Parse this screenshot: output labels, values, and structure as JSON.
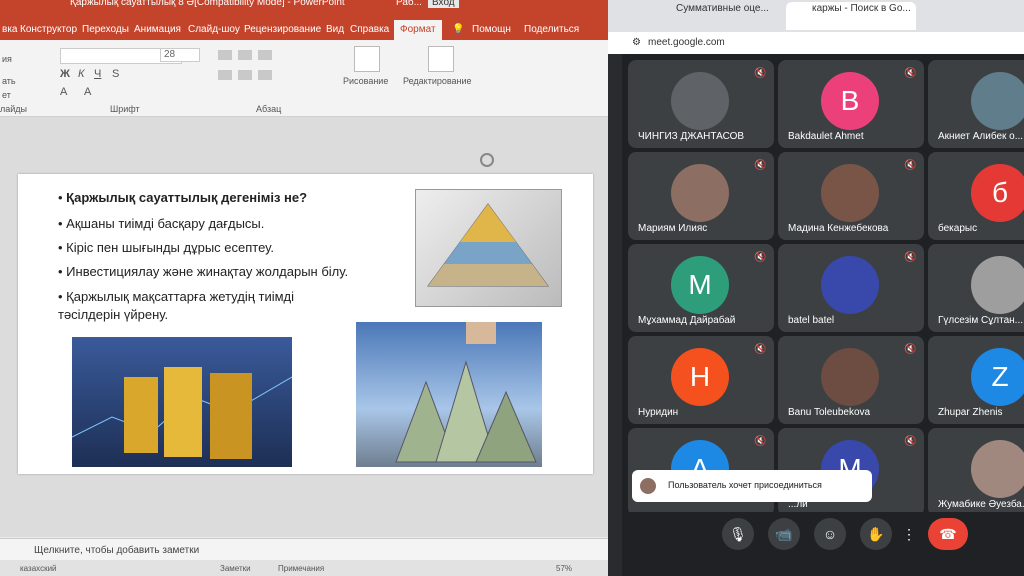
{
  "ppt": {
    "title": "Қаржылық сауаттылық 8 Ә[Compatibility Mode]  -  PowerPoint",
    "title_short": "Раб...",
    "login_label": "Вход",
    "tabs": [
      "вка",
      "Конструктор",
      "Переходы",
      "Анимация",
      "Слайд-шоу",
      "Рецензирование",
      "Вид",
      "Справка",
      "Формат",
      "Помощн",
      "Поделиться"
    ],
    "ribbon": {
      "font_size": "28",
      "section_font": "Шрифт",
      "section_paragraph": "Абзац",
      "section_slides": "лайды",
      "drawing": "Рисование",
      "editing": "Редактирование",
      "left_items": [
        "ать",
        "ет",
        "ия"
      ]
    },
    "slide": {
      "bullets": [
        "Қаржылық сауаттылық дегеніміз не?",
        "Ақшаны тиімді басқару дағдысы.",
        "Кіріс пен шығынды дұрыс есептеу.",
        "Инвестициялау және жинақтау жолдарын білу.",
        "Қаржылық мақсаттарға жетудің тиімді тәсілдерін үйрену."
      ]
    },
    "notes_placeholder": "Щелкните, чтобы добавить заметки",
    "status": {
      "language": "казахский",
      "notes": "Заметки",
      "comments": "Примечания",
      "zoom": "57%"
    }
  },
  "chrome": {
    "tabs": [
      "Суммативные оце...",
      "каржы - Поиск в Go..."
    ],
    "address": "meet.google.com"
  },
  "meet": {
    "participants": [
      {
        "name": "ЧИНГИЗ ДЖАНТАСОВ",
        "initial": "",
        "color": "#5f6368"
      },
      {
        "name": "Bakdaulet Ahmet",
        "initial": "B",
        "color": "#ec407a"
      },
      {
        "name": "Акниет Алибек о...",
        "initial": "",
        "color": "#607d8b"
      },
      {
        "name": "Мариям Илияс",
        "initial": "",
        "color": "#8d6e63"
      },
      {
        "name": "Мадина Кенжебекова",
        "initial": "",
        "color": "#795548"
      },
      {
        "name": "бекарыс",
        "initial": "б",
        "color": "#e53935"
      },
      {
        "name": "Мұхаммад Дайрабай",
        "initial": "M",
        "color": "#2e9e7a"
      },
      {
        "name": "batel batel",
        "initial": "",
        "color": "#3949ab"
      },
      {
        "name": "Гүлсезім Сұлтан...",
        "initial": "",
        "color": "#9e9e9e"
      },
      {
        "name": "Нуридин",
        "initial": "H",
        "color": "#f4511e"
      },
      {
        "name": "Banu Toleubekova",
        "initial": "",
        "color": "#6d4c41"
      },
      {
        "name": "Zhupar Zhenis",
        "initial": "Z",
        "color": "#1e88e5"
      },
      {
        "name": "",
        "initial": "A",
        "color": "#1e88e5"
      },
      {
        "name": "...ли",
        "initial": "M",
        "color": "#3949ab"
      },
      {
        "name": "Жумабике Әуезба...",
        "initial": "",
        "color": "#a1887f"
      }
    ],
    "join_notice": "Пользователь хочет присоединиться"
  }
}
